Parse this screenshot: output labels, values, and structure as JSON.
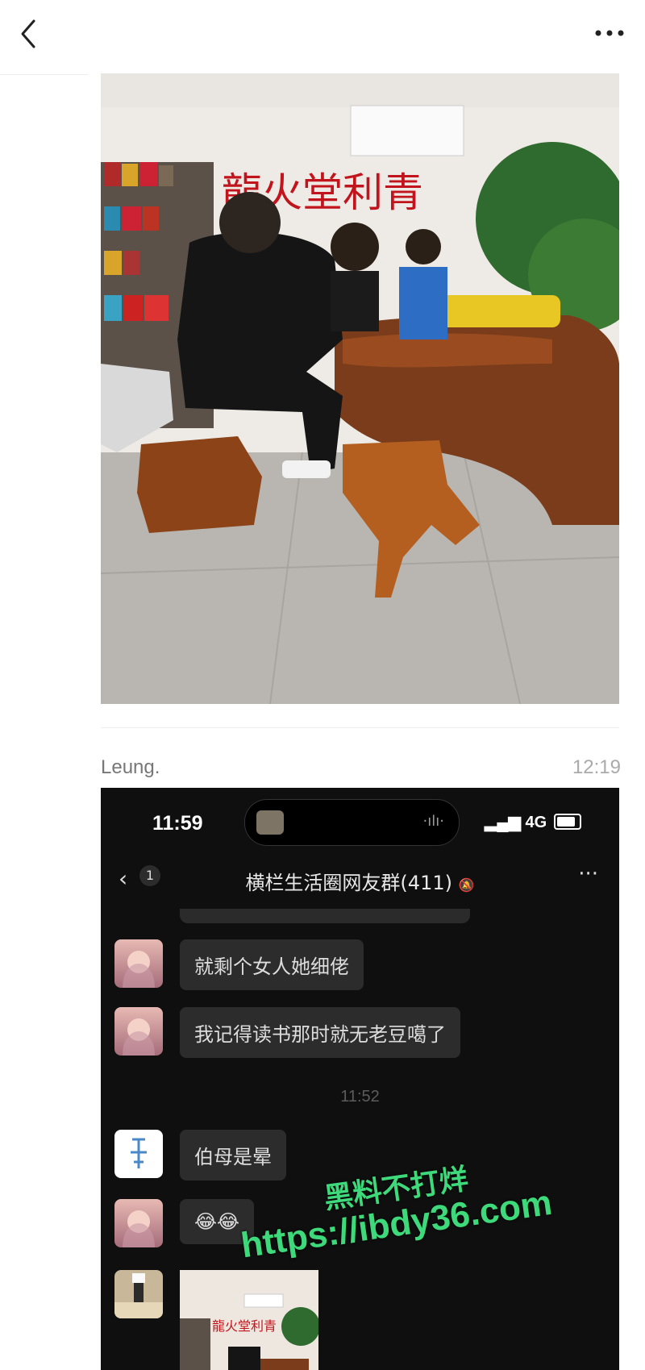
{
  "post": {
    "author": "Leung.",
    "time": "12:19"
  },
  "photo": {
    "sign_text": "龍火堂利青"
  },
  "screenshot": {
    "status_time": "11:59",
    "network": "4G",
    "chat_badge": "1",
    "chat_title": "横栏生活圈网友群(411)",
    "messages": [
      {
        "type": "text",
        "text": "就剩个女人她细佬"
      },
      {
        "type": "text",
        "text": "我记得读书那时就无老豆噶了"
      },
      {
        "type": "time",
        "text": "11:52"
      },
      {
        "type": "text",
        "text": "伯母是晕"
      },
      {
        "type": "emoji",
        "text": "😂😂"
      },
      {
        "type": "image"
      }
    ]
  },
  "watermark": {
    "line1": "黑料不打烊",
    "line2": "https://ibdy36.com"
  },
  "colors": {
    "chat_bg": "#0f0f0f",
    "bubble": "#2c2c2c",
    "watermark": "#3dd97a"
  }
}
